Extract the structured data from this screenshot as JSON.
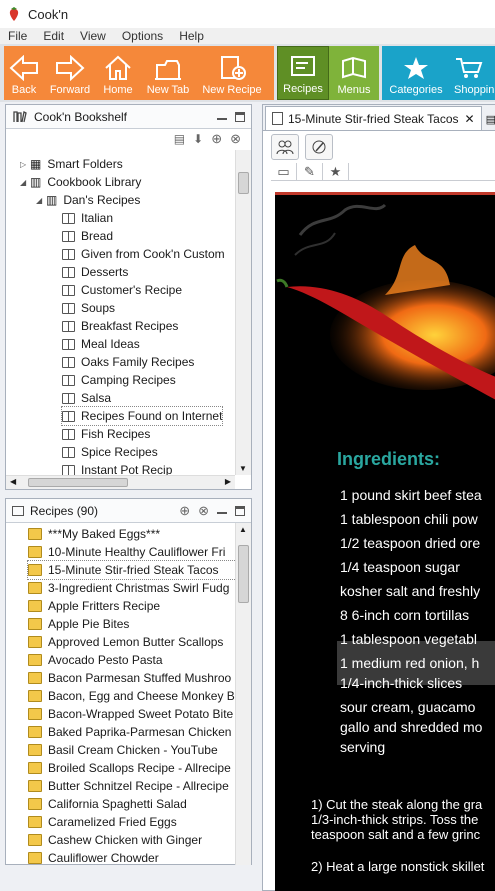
{
  "window": {
    "title": "Cook'n"
  },
  "menubar": [
    "File",
    "Edit",
    "View",
    "Options",
    "Help"
  ],
  "toolbar": {
    "orange": [
      {
        "label": "Back",
        "icon": "arrow-left-icon"
      },
      {
        "label": "Forward",
        "icon": "arrow-right-icon"
      },
      {
        "label": "Home",
        "icon": "home-icon"
      },
      {
        "label": "New Tab",
        "icon": "new-tab-icon"
      },
      {
        "label": "New Recipe",
        "icon": "new-recipe-icon"
      }
    ],
    "green": [
      {
        "label": "Recipes",
        "icon": "recipes-icon",
        "active": true
      },
      {
        "label": "Menus",
        "icon": "menus-icon"
      }
    ],
    "teal": [
      {
        "label": "Categories",
        "icon": "star-icon"
      },
      {
        "label": "Shoppin",
        "icon": "cart-icon"
      }
    ]
  },
  "bookshelf": {
    "title": "Cook'n Bookshelf",
    "smart_folders": "Smart Folders",
    "cookbook_library": "Cookbook Library",
    "owner_folder": "Dan's Recipes",
    "cookbooks": [
      "Italian",
      "Bread",
      "Given from Cook'n Custom",
      "Desserts",
      "Customer's Recipe",
      "Soups",
      "Breakfast Recipes",
      "Meal Ideas",
      "Oaks Family Recipes",
      "Camping Recipes",
      "Salsa",
      "Recipes Found on Internet",
      "Fish Recipes",
      "Spice Recipes",
      "Instant Pot Recip"
    ]
  },
  "recipes": {
    "title": "Recipes (90)",
    "items": [
      "***My Baked Eggs***",
      "10-Minute Healthy Cauliflower Fri",
      "15-Minute Stir-fried Steak Tacos",
      "3-Ingredient Christmas Swirl Fudg",
      "Apple Fritters Recipe",
      "Apple Pie Bites",
      "Approved Lemon Butter Scallops",
      "Avocado Pesto Pasta",
      "Bacon Parmesan Stuffed Mushroo",
      "Bacon, Egg and Cheese Monkey B",
      "Bacon-Wrapped Sweet Potato Bite",
      "Baked Paprika-Parmesan Chicken",
      "Basil Cream Chicken - YouTube",
      "Broiled Scallops Recipe - Allrecipe",
      "Butter Schnitzel Recipe - Allrecipe",
      "California Spaghetti Salad",
      "Caramelized Fried Eggs",
      "Cashew Chicken with Ginger",
      "Cauliflower Chowder"
    ]
  },
  "viewer": {
    "tab_title": "15-Minute Stir-fried Steak Tacos",
    "ingredients_heading": "Ingredients:",
    "ingredients": [
      "1 pound skirt beef stea",
      "1 tablespoon chili pow",
      "1/2 teaspoon dried ore",
      "1/4 teaspoon sugar",
      "kosher salt and freshly",
      "8 6-inch corn tortillas",
      "1 tablespoon vegetabl",
      "1 medium red onion, h",
      "1/4-inch-thick slices",
      "sour cream, guacamo",
      "gallo and shredded mo",
      "serving"
    ],
    "steps": [
      "1) Cut the steak along the gra",
      "1/3-inch-thick strips. Toss the",
      "teaspoon salt and a few grinc",
      "2) Heat a large nonstick skillet"
    ]
  },
  "colors": {
    "orange_group": "#f5883a",
    "green_group": "#7fb33a",
    "teal_group": "#1aa3c9",
    "ingredients_heading": "#2aa7a0"
  }
}
